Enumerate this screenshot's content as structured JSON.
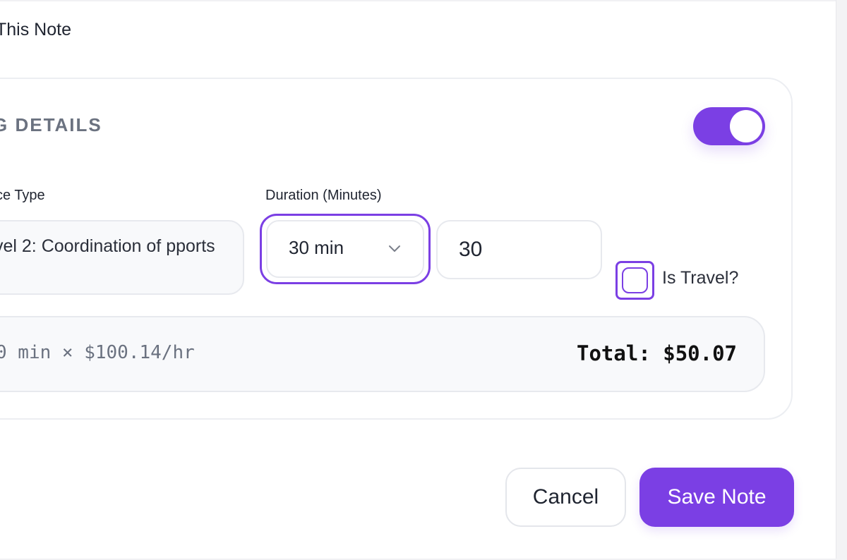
{
  "note": {
    "heading": "This Note"
  },
  "billing": {
    "section_title": "ING DETAILS",
    "toggle_enabled": true,
    "service_type_label": "ce Type",
    "service_type_value": "vel 2: Coordination of pports",
    "duration_label": "Duration (Minutes)",
    "duration_selected": "30 min",
    "duration_minutes_value": "30",
    "is_travel_label": "Is Travel?",
    "is_travel_checked": false,
    "calc_formula": "0 min × $100.14/hr",
    "calc_total": "Total: $50.07"
  },
  "actions": {
    "cancel_label": "Cancel",
    "save_label": "Save Note"
  },
  "colors": {
    "accent": "#7b3fe4"
  }
}
